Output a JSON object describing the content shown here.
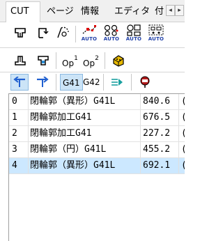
{
  "tabs": [
    {
      "label": "CUT",
      "active": true
    },
    {
      "label": "ページ",
      "active": false
    },
    {
      "label": "情報",
      "active": false
    },
    {
      "label": "エディタ",
      "active": false
    },
    {
      "label": "付",
      "active": false
    }
  ],
  "tab_scroll": {
    "left": "◂",
    "right": "▸"
  },
  "toolbar1": {
    "auto_label": "AUTO"
  },
  "toolbar2": {
    "op1_label": "Op",
    "op1_sup": "1",
    "op2_label": "Op",
    "op2_sup": "2"
  },
  "toolbar3": {
    "g41_label": "G41",
    "g42_label": "G42"
  },
  "table": {
    "rows": [
      {
        "index": "0",
        "name": "閉輪郭（異形）G41L",
        "value": "840.6",
        "extra": "("
      },
      {
        "index": "1",
        "name": "閉輪郭加工G41",
        "value": "676.5",
        "extra": "("
      },
      {
        "index": "2",
        "name": "閉輪郭加工G41",
        "value": "227.2",
        "extra": "("
      },
      {
        "index": "3",
        "name": "閉輪郭（円）G41L",
        "value": "455.2",
        "extra": "("
      },
      {
        "index": "4",
        "name": "閉輪郭（異形）G41L",
        "value": "692.1",
        "extra": "("
      }
    ],
    "selected_index": 4
  },
  "colors": {
    "accent_blue": "#1f3fa8",
    "selection": "#cce8ff",
    "pressed": "#cce4f7"
  }
}
